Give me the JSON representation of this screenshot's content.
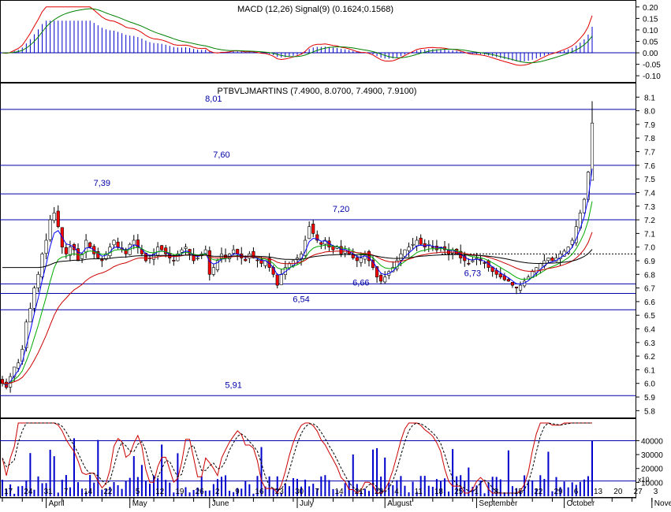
{
  "macd_panel": {
    "title": "MACD (12,26) Signal(9) (0.1624;0.1568)",
    "y_ticks": [
      "0.20",
      "0.15",
      "0.10",
      "0.05",
      "0.00",
      "-0.05",
      "-0.10"
    ],
    "y_values": [
      0.2,
      0.15,
      0.1,
      0.05,
      0.0,
      -0.05,
      -0.1
    ],
    "ylim": [
      -0.12,
      0.22
    ],
    "colors": {
      "macd": "#e00000",
      "signal": "#008000",
      "histogram": "#0000cc"
    }
  },
  "price_panel": {
    "title": "PTBVLJMARTINS (7.4900, 8.0700, 7.4900, 7.9100)",
    "y_ticks": [
      "8.1",
      "8.0",
      "7.9",
      "7.8",
      "7.7",
      "7.6",
      "7.5",
      "7.4",
      "7.3",
      "7.2",
      "7.1",
      "7.0",
      "6.9",
      "6.8",
      "6.7",
      "6.6",
      "6.5",
      "6.4",
      "6.3",
      "6.2",
      "6.1",
      "6.0",
      "5.9",
      "5.8"
    ],
    "y_values": [
      8.1,
      8.0,
      7.9,
      7.8,
      7.7,
      7.6,
      7.5,
      7.4,
      7.3,
      7.2,
      7.1,
      7.0,
      6.9,
      6.8,
      6.7,
      6.6,
      6.5,
      6.4,
      6.3,
      6.2,
      6.1,
      6.0,
      5.9,
      5.8
    ],
    "ylim": [
      5.75,
      8.2
    ],
    "level_lines": [
      {
        "label": "8,01",
        "value": 8.01,
        "label_day": 53
      },
      {
        "label": "7,60",
        "value": 7.6,
        "label_day": 55
      },
      {
        "label": "7,39",
        "value": 7.39,
        "label_day": 25
      },
      {
        "label": "7,20",
        "value": 7.2,
        "label_day": 85
      },
      {
        "label": "6,73",
        "value": 6.73,
        "label_day": 118
      },
      {
        "label": "6,66",
        "value": 6.66,
        "label_day": 90
      },
      {
        "label": "6,54",
        "value": 6.54,
        "label_day": 75
      },
      {
        "label": "5,91",
        "value": 5.91,
        "label_day": 58
      }
    ],
    "colors": {
      "up": "#ffffff",
      "down": "#ff0000",
      "ma_short": "#0000ff",
      "ma_mid": "#00aa00",
      "ma_long": "#cc0000",
      "ma_xlong": "#000000",
      "level": "#0000aa",
      "dotted": "#000000"
    }
  },
  "volume_panel": {
    "y_ticks": [
      "40000",
      "30000",
      "20000",
      "10000"
    ],
    "y_values": [
      40000,
      30000,
      20000,
      10000
    ],
    "ylim": [
      0,
      55000
    ],
    "multiplier_label": "x10",
    "level_lines": [
      40000,
      11000
    ],
    "colors": {
      "bars": "#0000cc",
      "stoch_k": "#cc0000",
      "stoch_d": "#000000"
    }
  },
  "x_axis": {
    "day_ticks": [
      {
        "label": "17",
        "day": 0
      },
      {
        "label": "24",
        "day": 5
      },
      {
        "label": "31",
        "day": 10
      },
      {
        "label": "7",
        "day": 15
      },
      {
        "label": "14",
        "day": 20
      },
      {
        "label": "22",
        "day": 25
      },
      {
        "label": "5",
        "day": 33
      },
      {
        "label": "12",
        "day": 38
      },
      {
        "label": "19",
        "day": 43
      },
      {
        "label": "26",
        "day": 48
      },
      {
        "label": "2",
        "day": 53
      },
      {
        "label": "9",
        "day": 58
      },
      {
        "label": "16",
        "day": 63
      },
      {
        "label": "23",
        "day": 68
      },
      {
        "label": "30",
        "day": 73
      },
      {
        "label": "7",
        "day": 78
      },
      {
        "label": "14",
        "day": 83
      },
      {
        "label": "21",
        "day": 88
      },
      {
        "label": "28",
        "day": 93
      },
      {
        "label": "4",
        "day": 98
      },
      {
        "label": "11",
        "day": 103
      },
      {
        "label": "18",
        "day": 108
      },
      {
        "label": "25",
        "day": 113
      },
      {
        "label": "1",
        "day": 118
      },
      {
        "label": "8",
        "day": 123
      },
      {
        "label": "15",
        "day": 128
      },
      {
        "label": "22",
        "day": 133
      },
      {
        "label": "29",
        "day": 138
      },
      {
        "label": "6",
        "day": 143
      },
      {
        "label": "13",
        "day": 148
      },
      {
        "label": "20",
        "day": 153
      },
      {
        "label": "27",
        "day": 158
      },
      {
        "label": "3",
        "day": 163
      },
      {
        "label": "10",
        "day": 168
      }
    ],
    "month_ticks": [
      {
        "label": "April",
        "day": 11
      },
      {
        "label": "May",
        "day": 32
      },
      {
        "label": "June",
        "day": 52
      },
      {
        "label": "July",
        "day": 74
      },
      {
        "label": "August",
        "day": 96
      },
      {
        "label": "September",
        "day": 119
      },
      {
        "label": "October",
        "day": 141
      },
      {
        "label": "November",
        "day": 163
      }
    ]
  },
  "chart_data": {
    "type": "line",
    "title": "PTBVLJMARTINS (7.4900, 8.0700, 7.4900, 7.9100)",
    "xlabel": "",
    "ylabel": "",
    "ylim": [
      5.8,
      8.1
    ],
    "grid": false,
    "x_unit": "trading day index (0 = Mar 17, last = Oct 30)",
    "close": [
      6.0,
      5.97,
      6.05,
      6.12,
      6.15,
      6.25,
      6.45,
      6.55,
      6.7,
      6.8,
      6.95,
      7.05,
      7.2,
      7.25,
      7.15,
      7.0,
      6.95,
      7.0,
      6.98,
      6.9,
      6.95,
      7.05,
      7.0,
      6.95,
      6.92,
      6.9,
      6.95,
      7.0,
      7.05,
      7.0,
      6.98,
      6.95,
      7.02,
      7.05,
      7.0,
      6.95,
      6.9,
      6.92,
      6.95,
      7.0,
      6.98,
      6.95,
      6.92,
      6.9,
      6.95,
      6.98,
      7.0,
      6.95,
      6.9,
      6.92,
      6.95,
      6.98,
      6.8,
      6.85,
      6.9,
      6.95,
      6.92,
      6.95,
      6.98,
      6.95,
      6.92,
      6.9,
      6.95,
      6.92,
      6.9,
      6.88,
      6.9,
      6.85,
      6.8,
      6.72,
      6.8,
      6.85,
      6.88,
      6.9,
      6.92,
      6.95,
      7.05,
      7.15,
      7.1,
      7.05,
      7.02,
      7.05,
      7.0,
      6.98,
      7.0,
      6.95,
      6.98,
      6.95,
      6.92,
      6.9,
      6.92,
      6.95,
      6.9,
      6.85,
      6.78,
      6.75,
      6.78,
      6.82,
      6.85,
      6.9,
      6.95,
      6.98,
      7.0,
      7.02,
      7.05,
      7.02,
      7.0,
      7.02,
      7.0,
      6.98,
      7.0,
      6.98,
      6.95,
      6.98,
      6.95,
      6.92,
      6.9,
      6.88,
      6.9,
      6.92,
      6.9,
      6.88,
      6.85,
      6.82,
      6.8,
      6.78,
      6.76,
      6.75,
      6.72,
      6.7,
      6.72,
      6.75,
      6.78,
      6.82,
      6.85,
      6.88,
      6.9,
      6.92,
      6.9,
      6.92,
      6.95,
      6.97,
      7.0,
      7.05,
      7.15,
      7.25,
      7.35,
      7.55,
      7.91
    ],
    "series": [
      {
        "name": "MACD",
        "values_start": -0.1,
        "values_end": 0.1624
      },
      {
        "name": "Signal",
        "values_end": 0.1568
      }
    ],
    "last_bar": {
      "open": 7.49,
      "high": 8.07,
      "low": 7.49,
      "close": 7.91
    }
  }
}
